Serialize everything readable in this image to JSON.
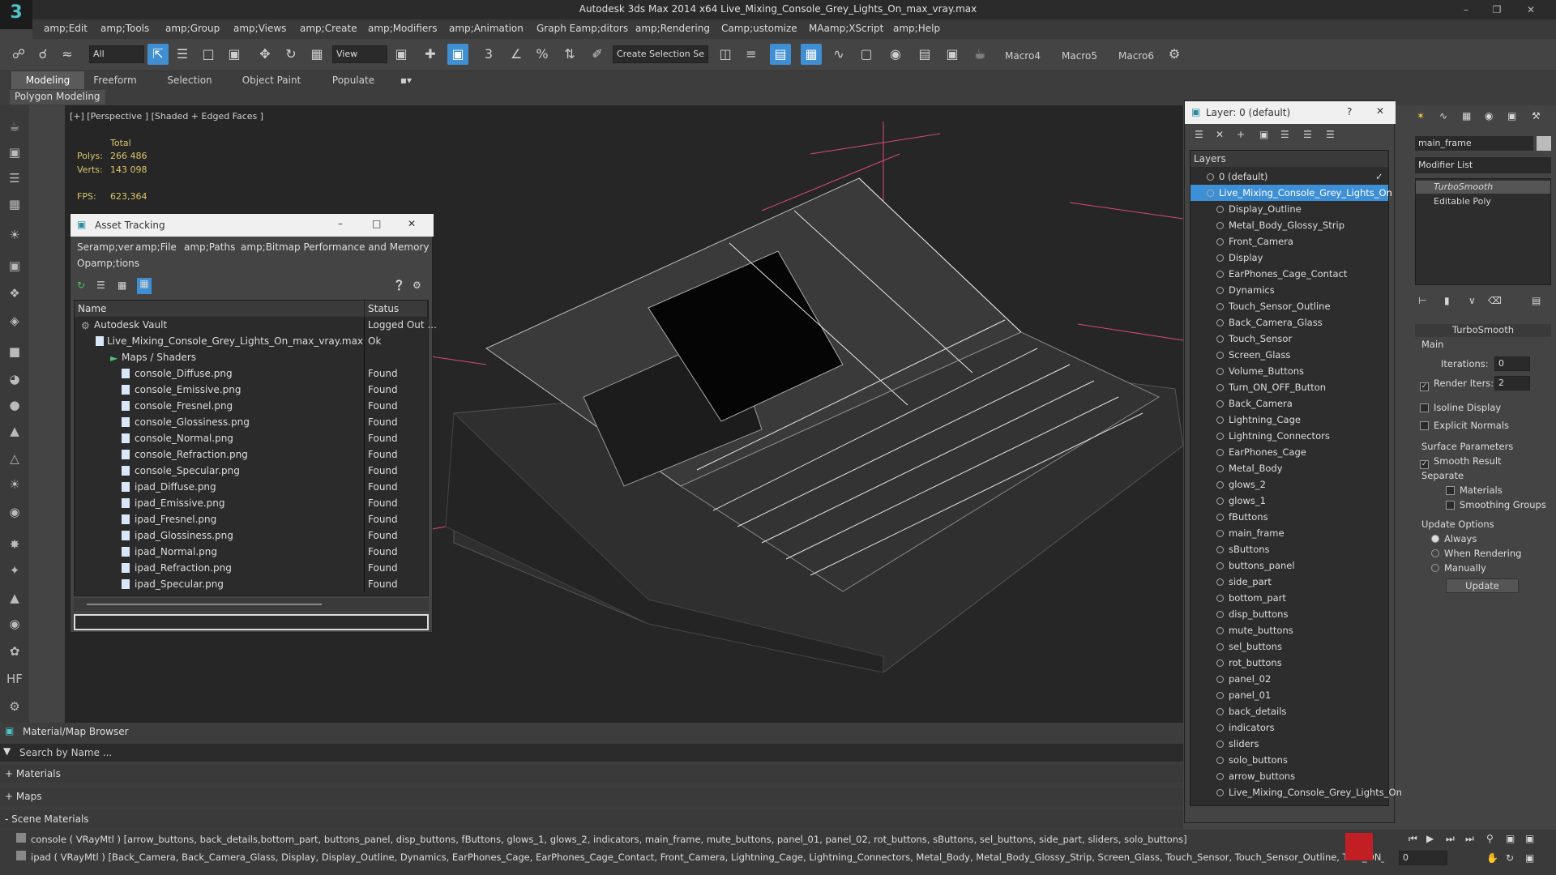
{
  "app": {
    "title": "Autodesk 3ds Max  2014 x64      Live_Mixing_Console_Grey_Lights_On_max_vray.max",
    "logo": "3"
  },
  "menubar": [
    "amp;Edit",
    "amp;Tools",
    "amp;Group",
    "amp;Views",
    "amp;Create",
    "amp;Modifiers",
    "amp;Animation",
    "Graph Eamp;ditors",
    "amp;Rendering",
    "Camp;ustomize",
    "MAamp;XScript",
    "amp;Help"
  ],
  "toolbar": {
    "selection_filter": "All",
    "ref_coord": "View",
    "selection_set": "Create Selection Se",
    "macros": [
      "Macro4",
      "Macro5",
      "Macro6"
    ]
  },
  "ribbon": {
    "tabs": [
      "Modeling",
      "Freeform",
      "Selection",
      "Object Paint",
      "Populate"
    ],
    "subtab": "Polygon Modeling"
  },
  "viewport": {
    "label": "[+] [Perspective ] [Shaded + Edged Faces ]",
    "stats": {
      "total_label": "Total",
      "polys_label": "Polys:",
      "polys": "266 486",
      "verts_label": "Verts:",
      "verts": "143 098",
      "fps_label": "FPS:",
      "fps": "623,364"
    }
  },
  "asset_tracking": {
    "title": "Asset Tracking",
    "menu": [
      "Seramp;ver",
      "amp;File",
      "amp;Paths",
      "amp;Bitmap Performance and Memory"
    ],
    "menu2": "Opamp;tions",
    "col_name": "Name",
    "col_status": "Status",
    "rows": [
      {
        "name": "Autodesk Vault",
        "status": "Logged Out ..."
      },
      {
        "name": "Live_Mixing_Console_Grey_Lights_On_max_vray.max",
        "status": "Ok"
      },
      {
        "name": "Maps / Shaders",
        "status": ""
      },
      {
        "name": "console_Diffuse.png",
        "status": "Found"
      },
      {
        "name": "console_Emissive.png",
        "status": "Found"
      },
      {
        "name": "console_Fresnel.png",
        "status": "Found"
      },
      {
        "name": "console_Glossiness.png",
        "status": "Found"
      },
      {
        "name": "console_Normal.png",
        "status": "Found"
      },
      {
        "name": "console_Refraction.png",
        "status": "Found"
      },
      {
        "name": "console_Specular.png",
        "status": "Found"
      },
      {
        "name": "ipad_Diffuse.png",
        "status": "Found"
      },
      {
        "name": "ipad_Emissive.png",
        "status": "Found"
      },
      {
        "name": "ipad_Fresnel.png",
        "status": "Found"
      },
      {
        "name": "ipad_Glossiness.png",
        "status": "Found"
      },
      {
        "name": "ipad_Normal.png",
        "status": "Found"
      },
      {
        "name": "ipad_Refraction.png",
        "status": "Found"
      },
      {
        "name": "ipad_Specular.png",
        "status": "Found"
      }
    ]
  },
  "layer_panel": {
    "title": "Layer: 0 (default)",
    "help": "?",
    "header": "Layers",
    "items": [
      "0 (default)",
      "Live_Mixing_Console_Grey_Lights_On",
      "Display_Outline",
      "Metal_Body_Glossy_Strip",
      "Front_Camera",
      "Display",
      "EarPhones_Cage_Contact",
      "Dynamics",
      "Touch_Sensor_Outline",
      "Back_Camera_Glass",
      "Touch_Sensor",
      "Screen_Glass",
      "Volume_Buttons",
      "Turn_ON_OFF_Button",
      "Back_Camera",
      "Lightning_Cage",
      "Lightning_Connectors",
      "EarPhones_Cage",
      "Metal_Body",
      "glows_2",
      "glows_1",
      "fButtons",
      "main_frame",
      "sButtons",
      "buttons_panel",
      "side_part",
      "bottom_part",
      "disp_buttons",
      "mute_buttons",
      "sel_buttons",
      "rot_buttons",
      "panel_02",
      "panel_01",
      "back_details",
      "indicators",
      "sliders",
      "solo_buttons",
      "arrow_buttons",
      "Live_Mixing_Console_Grey_Lights_On"
    ]
  },
  "command_panel": {
    "object_name": "main_frame",
    "modifier_list": "Modifier List",
    "stack": [
      "TurboSmooth",
      "Editable Poly"
    ],
    "rollout_title": "TurboSmooth",
    "main_label": "Main",
    "iterations_label": "Iterations:",
    "iterations": "0",
    "render_iters_label": "Render Iters:",
    "render_iters": "2",
    "isoline": "Isoline Display",
    "explicit_normals": "Explicit Normals",
    "surface_params": "Surface Parameters",
    "smooth_result": "Smooth Result",
    "separate": "Separate",
    "materials": "Materials",
    "smoothing_groups": "Smoothing Groups",
    "update_options": "Update Options",
    "always": "Always",
    "when_rendering": "When Rendering",
    "manually": "Manually",
    "update_button": "Update"
  },
  "material_browser": {
    "title": "Material/Map Browser",
    "search": "Search by Name ...",
    "sections": [
      "+ Materials",
      "+ Maps",
      "- Scene Materials"
    ]
  },
  "bottom": {
    "line1": "console ( VRayMtl ) [arrow_buttons, back_details,bottom_part, buttons_panel, disp_buttons, fButtons, glows_1, glows_2, indicators, main_frame, mute_buttons, panel_01, panel_02, rot_buttons, sButtons, sel_buttons, side_part, sliders, solo_buttons]",
    "line2": "ipad ( VRayMtl ) [Back_Camera, Back_Camera_Glass, Display, Display_Outline, Dynamics, EarPhones_Cage, EarPhones_Cage_Contact, Front_Camera, Lightning_Cage, Lightning_Connectors, Metal_Body, Metal_Body_Glossy_Strip, Screen_Glass, Touch_Sensor, Touch_Sensor_Outline, Turn_ON_OFF_Button, Volume_Buttons]",
    "frame": "0"
  }
}
